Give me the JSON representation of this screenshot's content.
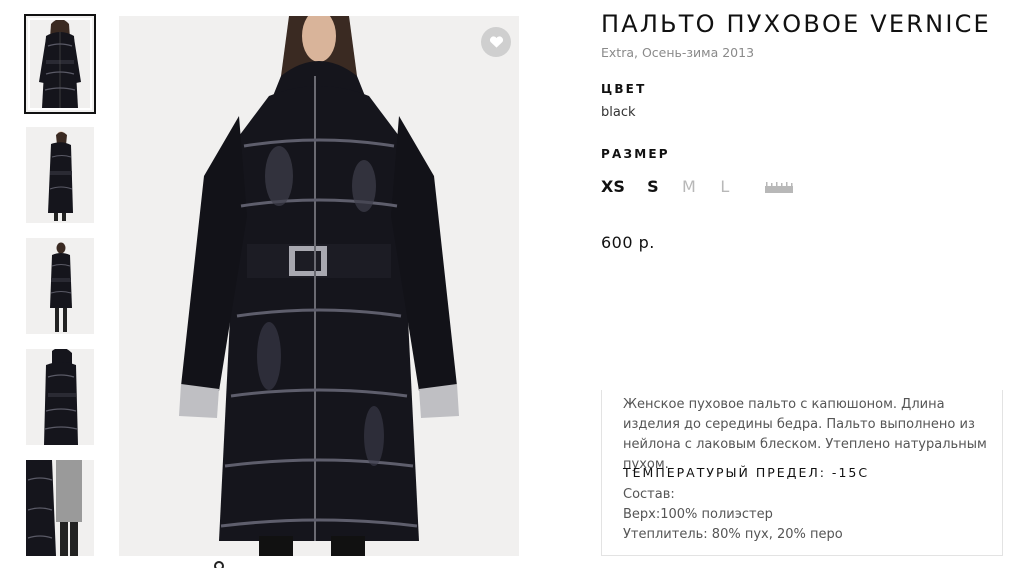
{
  "product": {
    "title": "ПАЛЬТО ПУХОВОЕ VERNICE",
    "subtitle": "Extra, Осень-зима 2013",
    "color_label": "ЦВЕТ",
    "color_value": "black",
    "size_label": "РАЗМЕР",
    "sizes": [
      {
        "label": "XS",
        "available": true
      },
      {
        "label": "S",
        "available": true
      },
      {
        "label": "M",
        "available": false
      },
      {
        "label": "L",
        "available": false
      }
    ],
    "price": "600 р."
  },
  "description": {
    "text": "Женское пуховое пальто с капюшоном. Длина изделия до середины бедра. Пальто выполнено из нейлона с лаковым блеском. Утеплено натуральным пухом.",
    "temperature": "ТЕМПЕРАТУРЫЙ ПРЕДЕЛ: -15С",
    "composition_label": "Состав:",
    "shell": "Верх:100% полиэстер",
    "filling": "Утеплитель: 80% пух, 20% перо"
  },
  "icons": {
    "favorite": "heart-icon",
    "size_guide": "ruler-icon"
  },
  "colors": {
    "coat": "#15151c",
    "background": "#f1f0ef",
    "fav_button": "#cfcfcf"
  }
}
